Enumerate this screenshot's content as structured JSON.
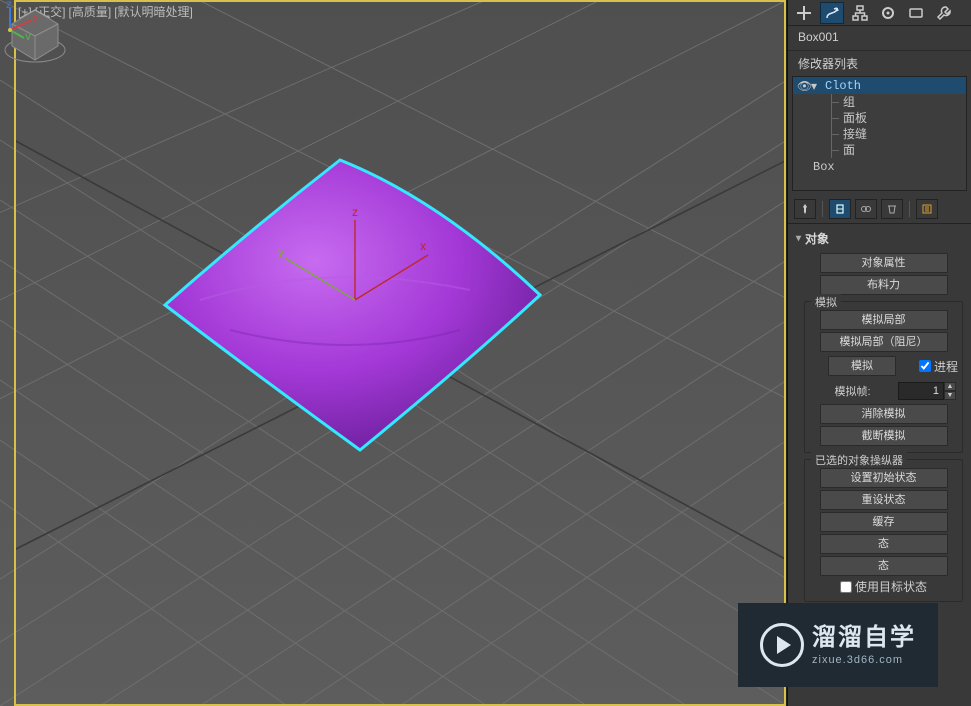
{
  "viewport": {
    "label_plus": "[+]",
    "label_ortho": "[正交]",
    "label_quality": "[高质量]",
    "label_shading": "[默认明暗处理]"
  },
  "object_name": "Box001",
  "modifier": {
    "list_label": "修改器列表",
    "stack": {
      "top_name": "Cloth",
      "sub1": "组",
      "sub2": "面板",
      "sub3": "接缝",
      "sub4": "面",
      "base": "Box"
    }
  },
  "rollout_object": {
    "title": "对象",
    "btn_props": "对象属性",
    "btn_force": "布料力",
    "group_sim": "模拟",
    "btn_sim_local": "模拟局部",
    "btn_sim_local_damp": "模拟局部（阻尼）",
    "btn_sim": "模拟",
    "chk_progress": "进程",
    "label_simframe": "模拟帧:",
    "val_simframe": "1",
    "btn_erase": "消除模拟",
    "btn_trunc": "截断模拟",
    "group_manip": "已选的对象操纵器",
    "btn_set_initial": "设置初始状态",
    "btn_reset_state": "重设状态",
    "btn_cache": "缓存",
    "btn_state_a": "态",
    "btn_state_b": "态",
    "chk_use_target": "使用目标状态"
  },
  "watermark": {
    "cn": "溜溜自学",
    "en": "zixue.3d66.com"
  }
}
